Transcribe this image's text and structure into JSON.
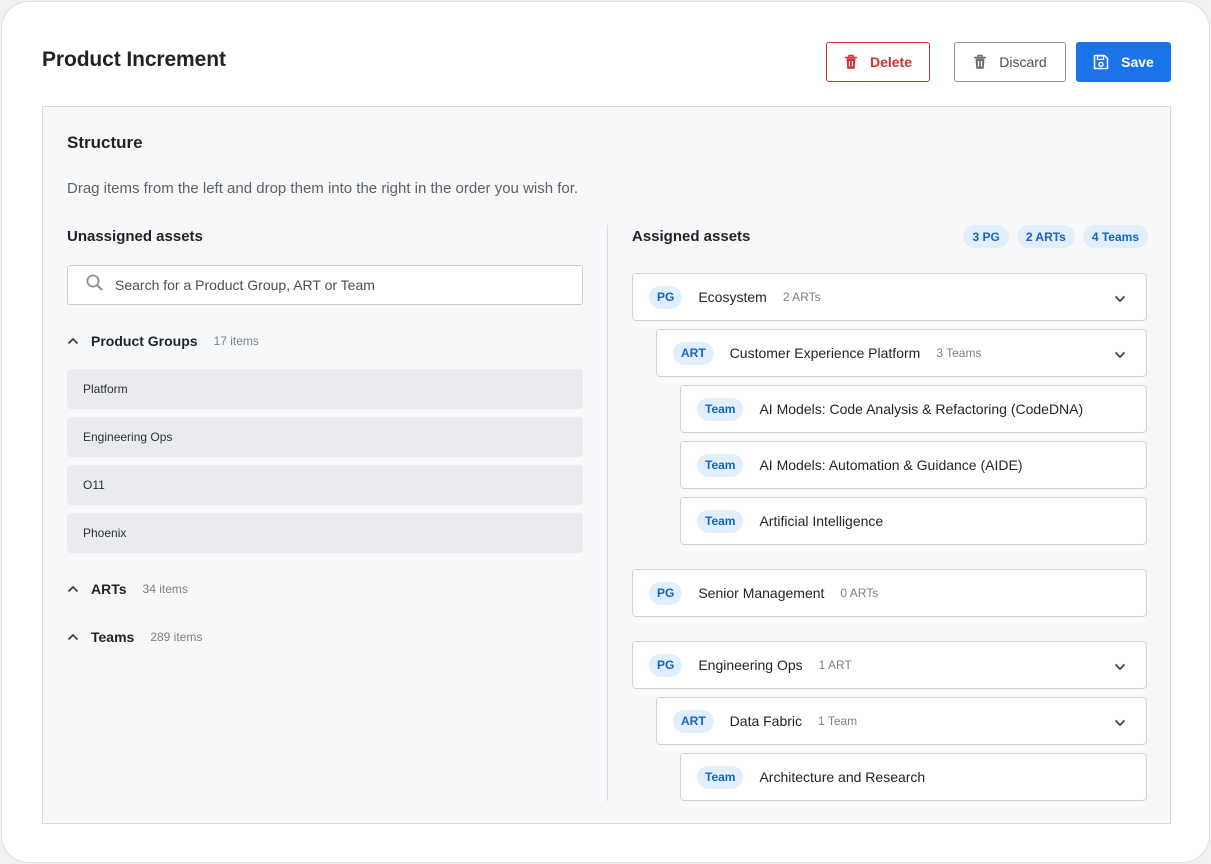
{
  "header": {
    "title": "Product Increment",
    "delete_label": "Delete",
    "discard_label": "Discard",
    "save_label": "Save"
  },
  "structure": {
    "title": "Structure",
    "description": "Drag items from the left and drop them into the right in the order you wish for."
  },
  "unassigned": {
    "title": "Unassigned assets",
    "search_placeholder": "Search for a Product Group, ART or Team",
    "groups": [
      {
        "name": "Product Groups",
        "count": "17 items",
        "items": [
          "Platform",
          "Engineering Ops",
          "O11",
          "Phoenix"
        ]
      },
      {
        "name": "ARTs",
        "count": "34 items"
      },
      {
        "name": "Teams",
        "count": "289 items"
      }
    ]
  },
  "assigned": {
    "title": "Assigned assets",
    "badges": [
      "3 PG",
      "2 ARTs",
      "4 Teams"
    ],
    "nodes": [
      {
        "tag": "PG",
        "name": "Ecosystem",
        "meta": "2 ARTs"
      },
      {
        "tag": "ART",
        "name": "Customer Experience Platform",
        "meta": "3 Teams"
      },
      {
        "tag": "Team",
        "name": "AI Models: Code Analysis & Refactoring (CodeDNA)"
      },
      {
        "tag": "Team",
        "name": "AI Models: Automation & Guidance (AIDE)"
      },
      {
        "tag": "Team",
        "name": "Artificial Intelligence"
      },
      {
        "tag": "PG",
        "name": "Senior Management",
        "meta": "0 ARTs"
      },
      {
        "tag": "PG",
        "name": "Engineering Ops",
        "meta": "1 ART"
      },
      {
        "tag": "ART",
        "name": "Data Fabric",
        "meta": "1 Team"
      },
      {
        "tag": "Team",
        "name": "Architecture and Research"
      }
    ]
  },
  "colors": {
    "primary": "#1a73e8",
    "danger": "#d32f2f",
    "tag_bg": "#e1eefb",
    "tag_text": "#1565c0",
    "item_bg": "#e9ebee"
  },
  "icons": {
    "delete": "trash-icon",
    "discard": "trash-icon",
    "save": "floppy-disk-icon",
    "search": "search-icon",
    "collapse": "chevron-up-icon",
    "expand": "chevron-down-icon"
  }
}
